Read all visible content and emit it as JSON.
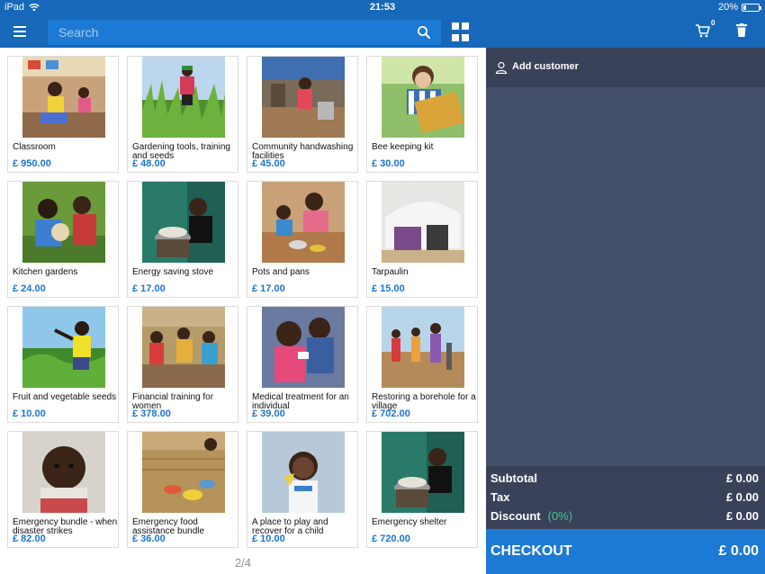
{
  "status_bar": {
    "device": "iPad",
    "time": "21:53",
    "battery": "20%",
    "battery_level": 0.2
  },
  "header": {
    "search_placeholder": "Search"
  },
  "cart": {
    "count": "0",
    "add_customer": "Add customer"
  },
  "colors": {
    "brand_blue": "#1768b8",
    "search_bg": "#1d7ad4",
    "panel_dark": "#3a4259",
    "panel": "#45506a",
    "price_blue": "#1a73d4",
    "discount_green": "#3fc79a"
  },
  "products": [
    {
      "name": "Classroom",
      "price": "£ 950.00",
      "art": "classroom"
    },
    {
      "name": "Gardening tools, training and seeds",
      "price": "£ 48.00",
      "art": "garden"
    },
    {
      "name": "Community handwashing facilities",
      "price": "£ 45.00",
      "art": "handwash"
    },
    {
      "name": "Bee keeping kit",
      "price": "£ 30.00",
      "art": "bees"
    },
    {
      "name": "Kitchen gardens",
      "price": "£ 24.00",
      "art": "kitchen"
    },
    {
      "name": "Energy saving stove",
      "price": "£ 17.00",
      "art": "stove"
    },
    {
      "name": "Pots and pans",
      "price": "£ 17.00",
      "art": "pots"
    },
    {
      "name": "Tarpaulin",
      "price": "£ 15.00",
      "art": "tarp"
    },
    {
      "name": "Fruit and vegetable seeds",
      "price": "£ 10.00",
      "art": "seeds"
    },
    {
      "name": "Financial training for women",
      "price": "£ 378.00",
      "art": "finance"
    },
    {
      "name": "Medical treatment for an individual",
      "price": "£ 39.00",
      "art": "medical"
    },
    {
      "name": "Restoring a borehole for a village",
      "price": "£ 702.00",
      "art": "borehole"
    },
    {
      "name": "Emergency bundle - when disaster strikes",
      "price": "£ 82.00",
      "art": "baby"
    },
    {
      "name": "Emergency food assistance bundle",
      "price": "£ 36.00",
      "art": "food"
    },
    {
      "name": "A place to play and recover for a child",
      "price": "£ 10.00",
      "art": "play"
    },
    {
      "name": "Emergency shelter",
      "price": "£ 720.00",
      "art": "shelter"
    }
  ],
  "pager": "2/4",
  "totals": {
    "subtotal_label": "Subtotal",
    "subtotal": "£ 0.00",
    "tax_label": "Tax",
    "tax": "£ 0.00",
    "discount_label": "Discount",
    "discount_pct": "(0%)",
    "discount": "£ 0.00"
  },
  "checkout": {
    "label": "CHECKOUT",
    "total": "£ 0.00"
  }
}
